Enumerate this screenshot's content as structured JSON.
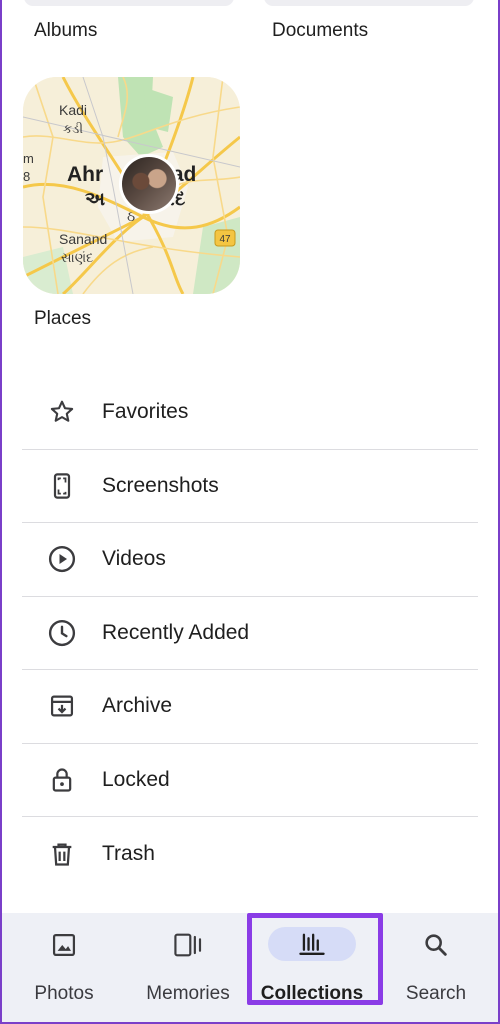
{
  "sections": {
    "albums_label": "Albums",
    "documents_label": "Documents",
    "places_label": "Places"
  },
  "map": {
    "labels": {
      "kadi": "Kadi",
      "kadi_gu": "કડી",
      "city": "Ahmedabad",
      "city_left": "Ahr",
      "city_right": "bad",
      "city_gu": "અ",
      "city_gu_right": "ાદ",
      "sanand": "Sanand",
      "sanand_gu": "સાણંદ",
      "edge_left_top": "m",
      "edge_left_bottom": "8",
      "small_glyph": "ઠ",
      "route": "47"
    }
  },
  "list": [
    {
      "label": "Favorites",
      "icon": "star-icon"
    },
    {
      "label": "Screenshots",
      "icon": "screenshot-icon"
    },
    {
      "label": "Videos",
      "icon": "play-circle-icon"
    },
    {
      "label": "Recently Added",
      "icon": "clock-icon"
    },
    {
      "label": "Archive",
      "icon": "archive-icon"
    },
    {
      "label": "Locked",
      "icon": "lock-icon"
    },
    {
      "label": "Trash",
      "icon": "trash-icon"
    }
  ],
  "nav": [
    {
      "label": "Photos",
      "icon": "photo-icon",
      "active": false
    },
    {
      "label": "Memories",
      "icon": "memories-icon",
      "active": false
    },
    {
      "label": "Collections",
      "icon": "collections-icon",
      "active": true
    },
    {
      "label": "Search",
      "icon": "search-icon",
      "active": false
    }
  ],
  "colors": {
    "frame": "#7a3fc9",
    "highlight": "#8a3ce6",
    "nav_bg": "#eef0f6",
    "active_pill": "#d6dcf7"
  }
}
